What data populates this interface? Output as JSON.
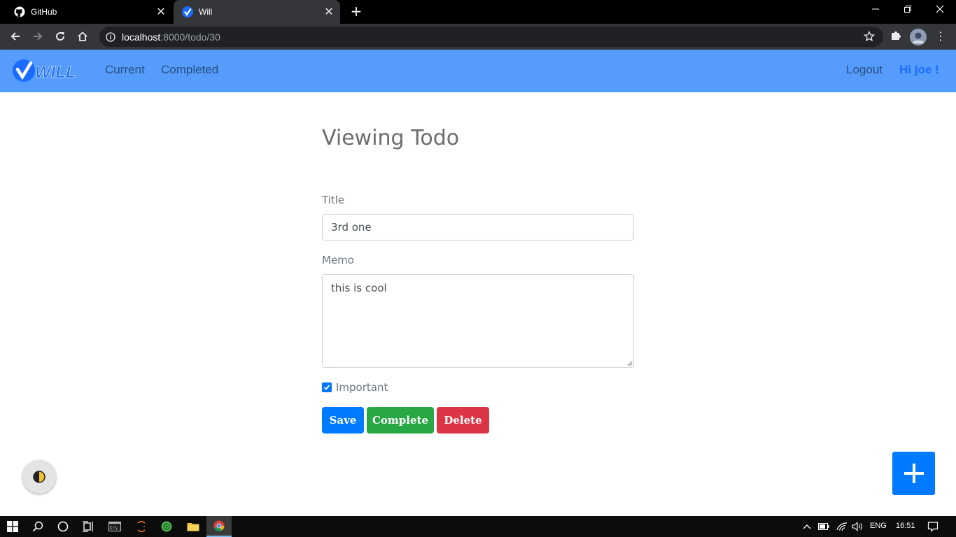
{
  "browser": {
    "tabs": [
      {
        "title": "GitHub",
        "icon": "github-icon"
      },
      {
        "title": "Will",
        "icon": "will-favicon"
      }
    ],
    "tab_close_glyph": "✕",
    "new_tab_glyph": "+",
    "window_controls": {
      "minimize": "—",
      "restore": "❐",
      "close": "✕"
    },
    "url_host": "localhost",
    "url_rest": ":8000/todo/30"
  },
  "navbar": {
    "brand": "WILL",
    "links": [
      "Current",
      "Completed"
    ],
    "logout": "Logout",
    "greeting": "Hi joe !"
  },
  "form": {
    "heading": "Viewing Todo",
    "title_label": "Title",
    "title_value": "3rd one",
    "memo_label": "Memo",
    "memo_value": "this is cool",
    "important_label": "Important",
    "important_checked": true,
    "buttons": {
      "save": "Save",
      "complete": "Complete",
      "delete": "Delete"
    }
  },
  "taskbar": {
    "language": "ENG",
    "time": "16:51"
  },
  "colors": {
    "navbar": "#559cfd",
    "primary": "#007bff",
    "success": "#28a745",
    "danger": "#dc3545"
  }
}
